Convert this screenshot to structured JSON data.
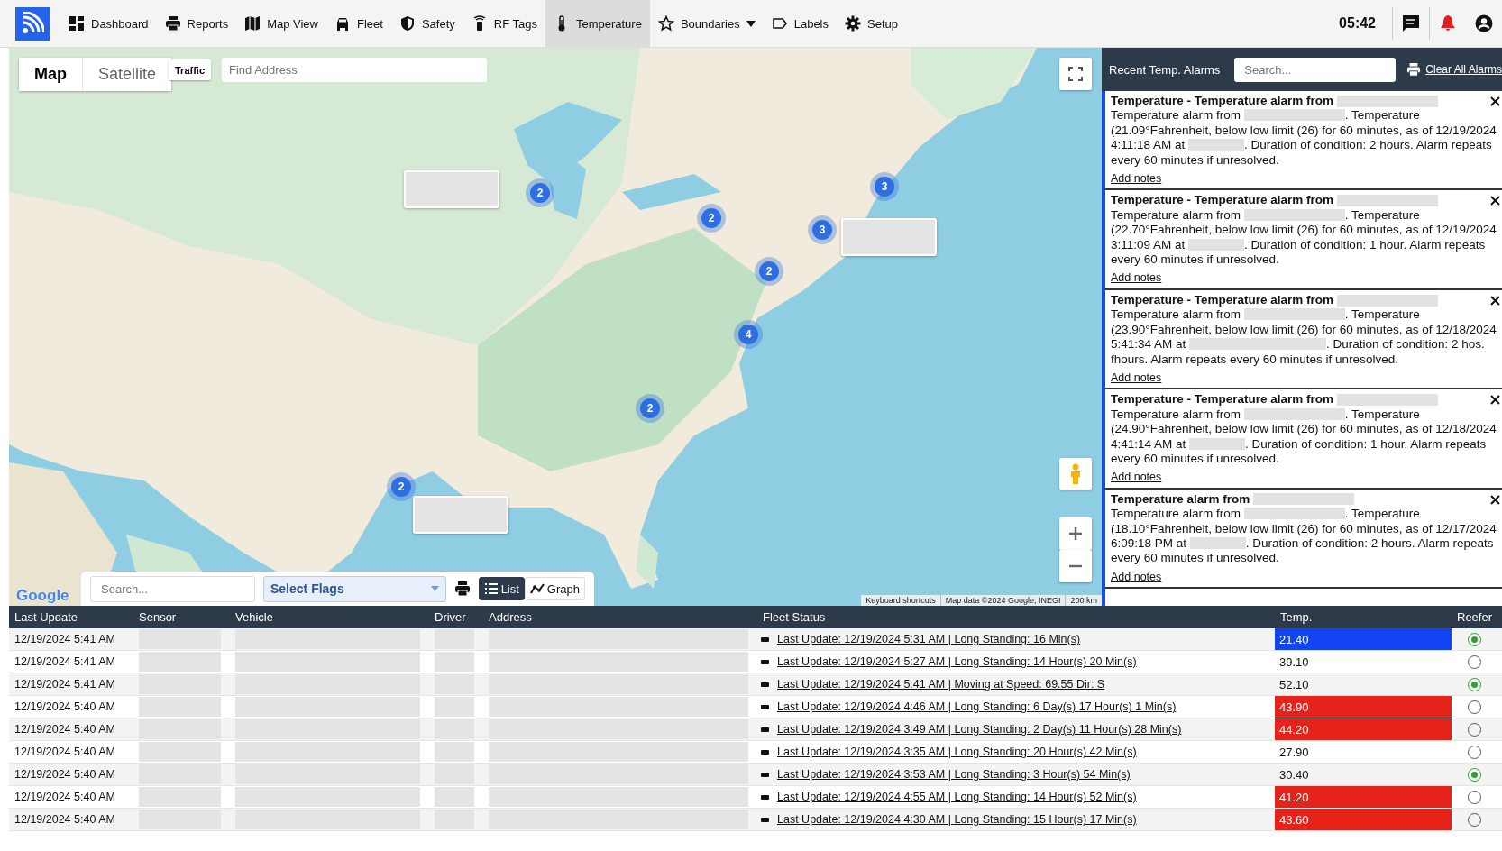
{
  "nav": {
    "items": [
      {
        "label": "Dashboard",
        "selected": false
      },
      {
        "label": "Reports",
        "selected": false
      },
      {
        "label": "Map View",
        "selected": false
      },
      {
        "label": "Fleet",
        "selected": false
      },
      {
        "label": "Safety",
        "selected": false
      },
      {
        "label": "RF Tags",
        "selected": false
      },
      {
        "label": "Temperature",
        "selected": true
      },
      {
        "label": "Boundaries",
        "selected": false,
        "dropdown": true
      },
      {
        "label": "Labels",
        "selected": false
      },
      {
        "label": "Setup",
        "selected": false
      }
    ],
    "time": "05:42"
  },
  "map": {
    "map_types": [
      {
        "label": "Map",
        "selected": true
      },
      {
        "label": "Satellite",
        "selected": false
      }
    ],
    "traffic_button": "Traffic",
    "address_placeholder": "Find Address",
    "clusters": [
      {
        "count": "2"
      },
      {
        "count": "2"
      },
      {
        "count": "3"
      },
      {
        "count": "3"
      },
      {
        "count": "2"
      },
      {
        "count": "4"
      },
      {
        "count": "2"
      },
      {
        "count": "2"
      }
    ],
    "callouts": [
      {
        "kind": "redacted"
      },
      {
        "kind": "redacted"
      },
      {
        "kind": "redacted"
      }
    ],
    "logo": "Google",
    "attributions": [
      "Keyboard shortcuts",
      "Map data ©2024 Google, INEGI",
      "200 km"
    ],
    "toolbar": {
      "search_placeholder": "Search...",
      "flags_select": "Select Flags",
      "views": [
        {
          "label": "List",
          "selected": true
        },
        {
          "label": "Graph",
          "selected": false
        }
      ]
    }
  },
  "alarms": {
    "title": "Recent Temp. Alarms",
    "search_placeholder": "Search...",
    "clear_link": "Clear All Alarms",
    "items": [
      {
        "title": "Temperature - Temperature alarm from",
        "message": [
          {
            "kind": "text",
            "text": "Temperature alarm from "
          },
          {
            "kind": "redacted-long"
          },
          {
            "kind": "text",
            "text": ". Temperature (21.09°Fahrenheit, below low limit (26) for 60 minutes, as of 12/19/2024 4:11:18 AM at "
          },
          {
            "kind": "redacted-short"
          },
          {
            "kind": "text",
            "text": ". Duration of condition: 2 hours. Alarm repeats every 60 minutes if unresolved."
          }
        ],
        "link": "Add notes"
      },
      {
        "title": "Temperature - Temperature alarm from",
        "message": [
          {
            "kind": "text",
            "text": "Temperature alarm from "
          },
          {
            "kind": "redacted-long"
          },
          {
            "kind": "text",
            "text": ". Temperature (22.70°Fahrenheit, below low limit (26) for 60 minutes, as of 12/19/2024 3:11:09 AM at "
          },
          {
            "kind": "redacted-short"
          },
          {
            "kind": "text",
            "text": ". Duration of condition: 1 hour. Alarm repeats every 60 minutes if unresolved."
          }
        ],
        "link": "Add notes"
      },
      {
        "title": "Temperature - Temperature alarm from",
        "message": [
          {
            "kind": "text",
            "text": "Temperature alarm from "
          },
          {
            "kind": "redacted-long"
          },
          {
            "kind": "text",
            "text": ". Temperature (23.90°Fahrenheit, below low limit (26) for 60 minutes, as of 12/18/2024 5:41:34 AM at "
          },
          {
            "kind": "redacted-wide"
          },
          {
            "kind": "text",
            "text": ". Duration of condition: 2 hos. fhours. Alarm repeats every 60 minutes if unresolved."
          }
        ],
        "link": "Add notes"
      },
      {
        "title": "Temperature - Temperature alarm from",
        "message": [
          {
            "kind": "text",
            "text": "Temperature alarm from "
          },
          {
            "kind": "redacted-long"
          },
          {
            "kind": "text",
            "text": ". Temperature (24.90°Fahrenheit, below low limit (26) for 60 minutes, as of 12/18/2024 4:41:14 AM at "
          },
          {
            "kind": "redacted-short"
          },
          {
            "kind": "text",
            "text": ". Duration of condition: 1 hour. Alarm repeats every 60 minutes if unresolved."
          }
        ],
        "link": "Add notes"
      },
      {
        "title": "Temperature alarm from",
        "message": [
          {
            "kind": "text",
            "text": "Temperature alarm from "
          },
          {
            "kind": "redacted-long"
          },
          {
            "kind": "text",
            "text": ". Temperature (18.10°Fahrenheit, below low limit (26) for 60 minutes, as of 12/17/2024 6:09:18 PM at "
          },
          {
            "kind": "redacted-short"
          },
          {
            "kind": "text",
            "text": ". Duration of condition: 2 hours. Alarm repeats every 60 minutes if unresolved."
          }
        ],
        "link": "Add notes"
      }
    ]
  },
  "table": {
    "columns": [
      "Last Update",
      "Sensor",
      "Vehicle",
      "Driver",
      "Address",
      "Fleet Status",
      "Temp.",
      "Reefer"
    ],
    "rows": [
      {
        "last_update": "12/19/2024 5:41 AM",
        "fleet_status": "Last Update: 12/19/2024 5:31 AM | Long Standing: 16 Min(s)",
        "temp": "21.40",
        "color": "#1244f5",
        "reefer_on": true
      },
      {
        "last_update": "12/19/2024 5:41 AM",
        "fleet_status": "Last Update: 12/19/2024 5:27 AM | Long Standing: 14 Hour(s) 20 Min(s)",
        "temp": "39.10",
        "reefer_on": false
      },
      {
        "last_update": "12/19/2024 5:41 AM",
        "fleet_status": "Last Update: 12/19/2024 5:41 AM | Moving at Speed: 69.55 Dir: S",
        "temp": "52.10",
        "reefer_on": true
      },
      {
        "last_update": "12/19/2024 5:40 AM",
        "fleet_status": "Last Update: 12/19/2024 4:46 AM | Long Standing: 6 Day(s) 17 Hour(s) 1 Min(s)",
        "temp": "43.90",
        "color": "#e5231b",
        "reefer_on": false
      },
      {
        "last_update": "12/19/2024 5:40 AM",
        "fleet_status": "Last Update: 12/19/2024 3:49 AM | Long Standing: 2 Day(s) 11 Hour(s) 28 Min(s)",
        "temp": "44.20",
        "color": "#e5231b",
        "reefer_on": false
      },
      {
        "last_update": "12/19/2024 5:40 AM",
        "fleet_status": "Last Update: 12/19/2024 3:35 AM | Long Standing: 20 Hour(s) 42 Min(s)",
        "temp": "27.90",
        "reefer_on": false
      },
      {
        "last_update": "12/19/2024 5:40 AM",
        "fleet_status": "Last Update: 12/19/2024 3:53 AM | Long Standing: 3 Hour(s) 54 Min(s)",
        "temp": "30.40",
        "reefer_on": true
      },
      {
        "last_update": "12/19/2024 5:40 AM",
        "fleet_status": "Last Update: 12/19/2024 4:55 AM | Long Standing: 14 Hour(s) 52 Min(s)",
        "temp": "41.20",
        "color": "#e5231b",
        "reefer_on": false
      },
      {
        "last_update": "12/19/2024 5:40 AM",
        "fleet_status": "Last Update: 12/19/2024 4:30 AM | Long Standing: 15 Hour(s) 17 Min(s)",
        "temp": "43.60",
        "color": "#e5231b",
        "reefer_on": false
      }
    ]
  }
}
